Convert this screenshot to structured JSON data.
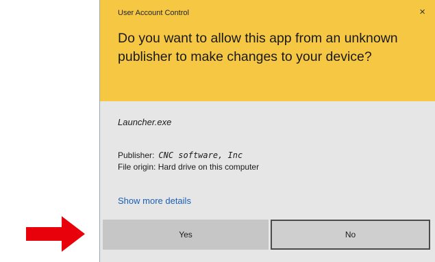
{
  "dialog": {
    "title": "User Account Control",
    "close_glyph": "×",
    "question": "Do you want to allow this app from an unknown publisher to make changes to your device?",
    "app_name": "Launcher.exe",
    "publisher_label": "Publisher:",
    "publisher_value": "CNC software, Inc",
    "origin_text": "File origin: Hard drive on this computer",
    "details_link": "Show more details",
    "yes_label": "Yes",
    "no_label": "No"
  },
  "colors": {
    "header_bg": "#f6c743",
    "body_bg": "#e6e6e6",
    "link": "#1a5fb4",
    "arrow": "#e8000b"
  },
  "icons": {
    "close": "close-icon",
    "annotation": "red-arrow-icon"
  }
}
